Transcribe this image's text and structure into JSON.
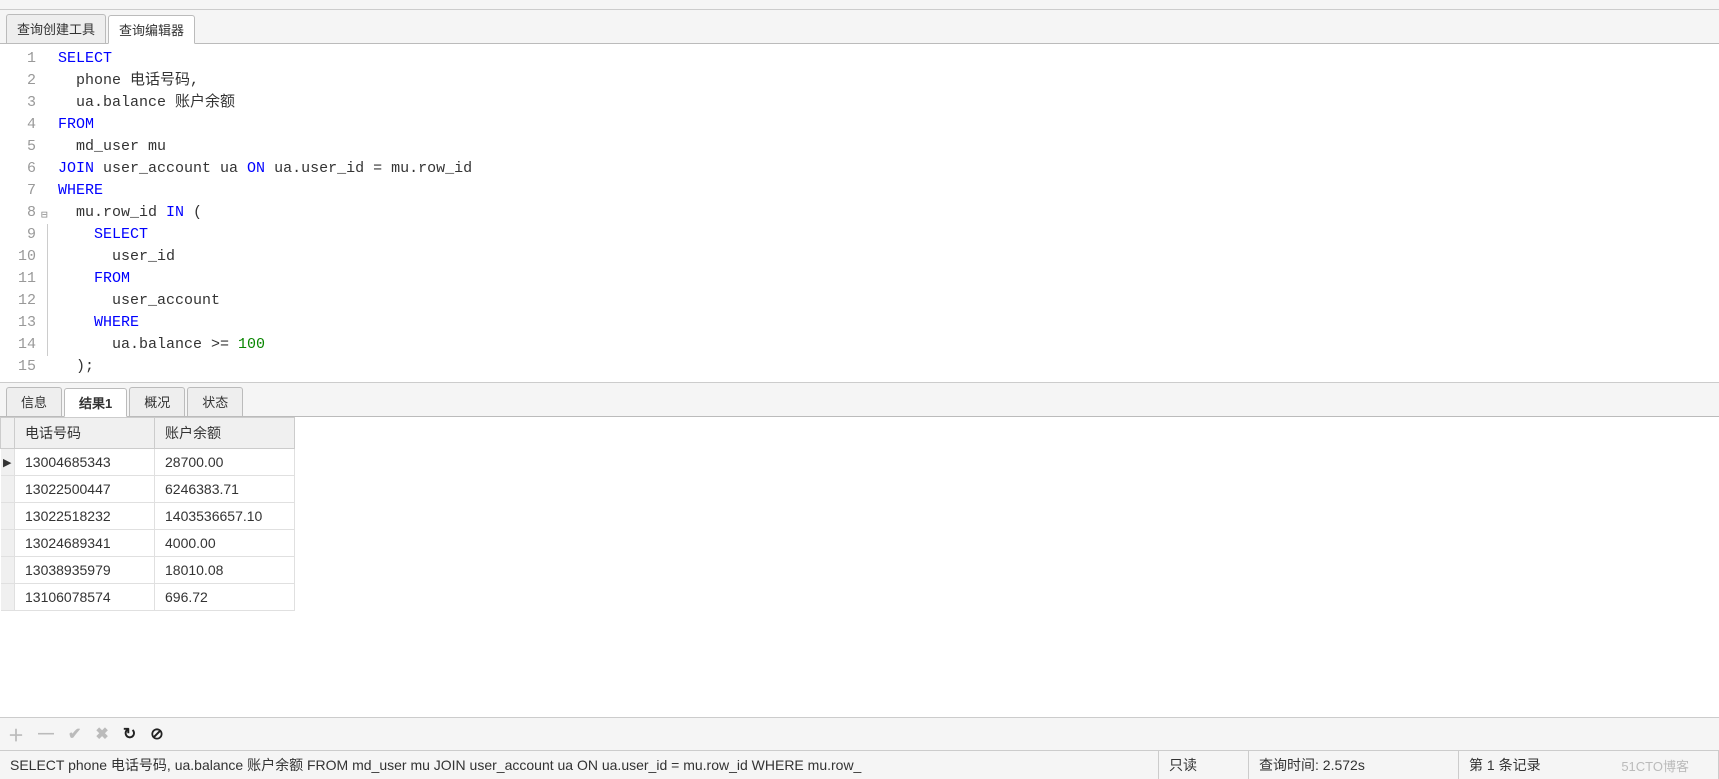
{
  "top_tabs": {
    "builder": "查询创建工具",
    "editor": "查询编辑器"
  },
  "code": {
    "lines": [
      {
        "n": "1",
        "fold": "",
        "html": "<span class='kw'>SELECT</span>"
      },
      {
        "n": "2",
        "fold": "",
        "html": "  phone 电话号码,"
      },
      {
        "n": "3",
        "fold": "",
        "html": "  ua.balance 账户余额"
      },
      {
        "n": "4",
        "fold": "",
        "html": "<span class='kw'>FROM</span>"
      },
      {
        "n": "5",
        "fold": "",
        "html": "  md_user mu"
      },
      {
        "n": "6",
        "fold": "",
        "html": "<span class='kw'>JOIN</span> user_account ua <span class='kw'>ON</span> ua.user_id = mu.row_id"
      },
      {
        "n": "7",
        "fold": "",
        "html": "<span class='kw'>WHERE</span>"
      },
      {
        "n": "8",
        "fold": "⊟",
        "html": "  mu.row_id <span class='kw'>IN</span> ("
      },
      {
        "n": "9",
        "fold": "|",
        "html": "    <span class='kw'>SELECT</span>"
      },
      {
        "n": "10",
        "fold": "|",
        "html": "      user_id"
      },
      {
        "n": "11",
        "fold": "|",
        "html": "    <span class='kw'>FROM</span>"
      },
      {
        "n": "12",
        "fold": "|",
        "html": "      user_account"
      },
      {
        "n": "13",
        "fold": "|",
        "html": "    <span class='kw'>WHERE</span>"
      },
      {
        "n": "14",
        "fold": "|",
        "html": "      ua.balance &gt;= <span class='num'>100</span>"
      },
      {
        "n": "15",
        "fold": "",
        "html": "  );"
      }
    ]
  },
  "result_tabs": {
    "info": "信息",
    "result1": "结果1",
    "profile": "概况",
    "status": "状态"
  },
  "grid": {
    "columns": [
      "电话号码",
      "账户余额"
    ],
    "rows": [
      {
        "marker": "▶",
        "phone": "13004685343",
        "balance": "28700.00"
      },
      {
        "marker": "",
        "phone": "13022500447",
        "balance": "6246383.71"
      },
      {
        "marker": "",
        "phone": "13022518232",
        "balance": "1403536657.10"
      },
      {
        "marker": "",
        "phone": "13024689341",
        "balance": "4000.00"
      },
      {
        "marker": "",
        "phone": "13038935979",
        "balance": "18010.08"
      },
      {
        "marker": "",
        "phone": "13106078574",
        "balance": "696.72"
      }
    ]
  },
  "actions": {
    "add": "＋",
    "remove": "—",
    "apply": "✔",
    "cancel": "✖",
    "refresh": "↻",
    "stop": "⊘"
  },
  "status": {
    "query": "SELECT phone 电话号码, ua.balance 账户余额  FROM md_user mu JOIN user_account ua ON ua.user_id = mu.row_id WHERE mu.row_",
    "readonly": "只读",
    "time_label": "查询时间: ",
    "time_value": "2.572s",
    "record": "第 1 条记录",
    "watermark": "51CTO博客"
  }
}
